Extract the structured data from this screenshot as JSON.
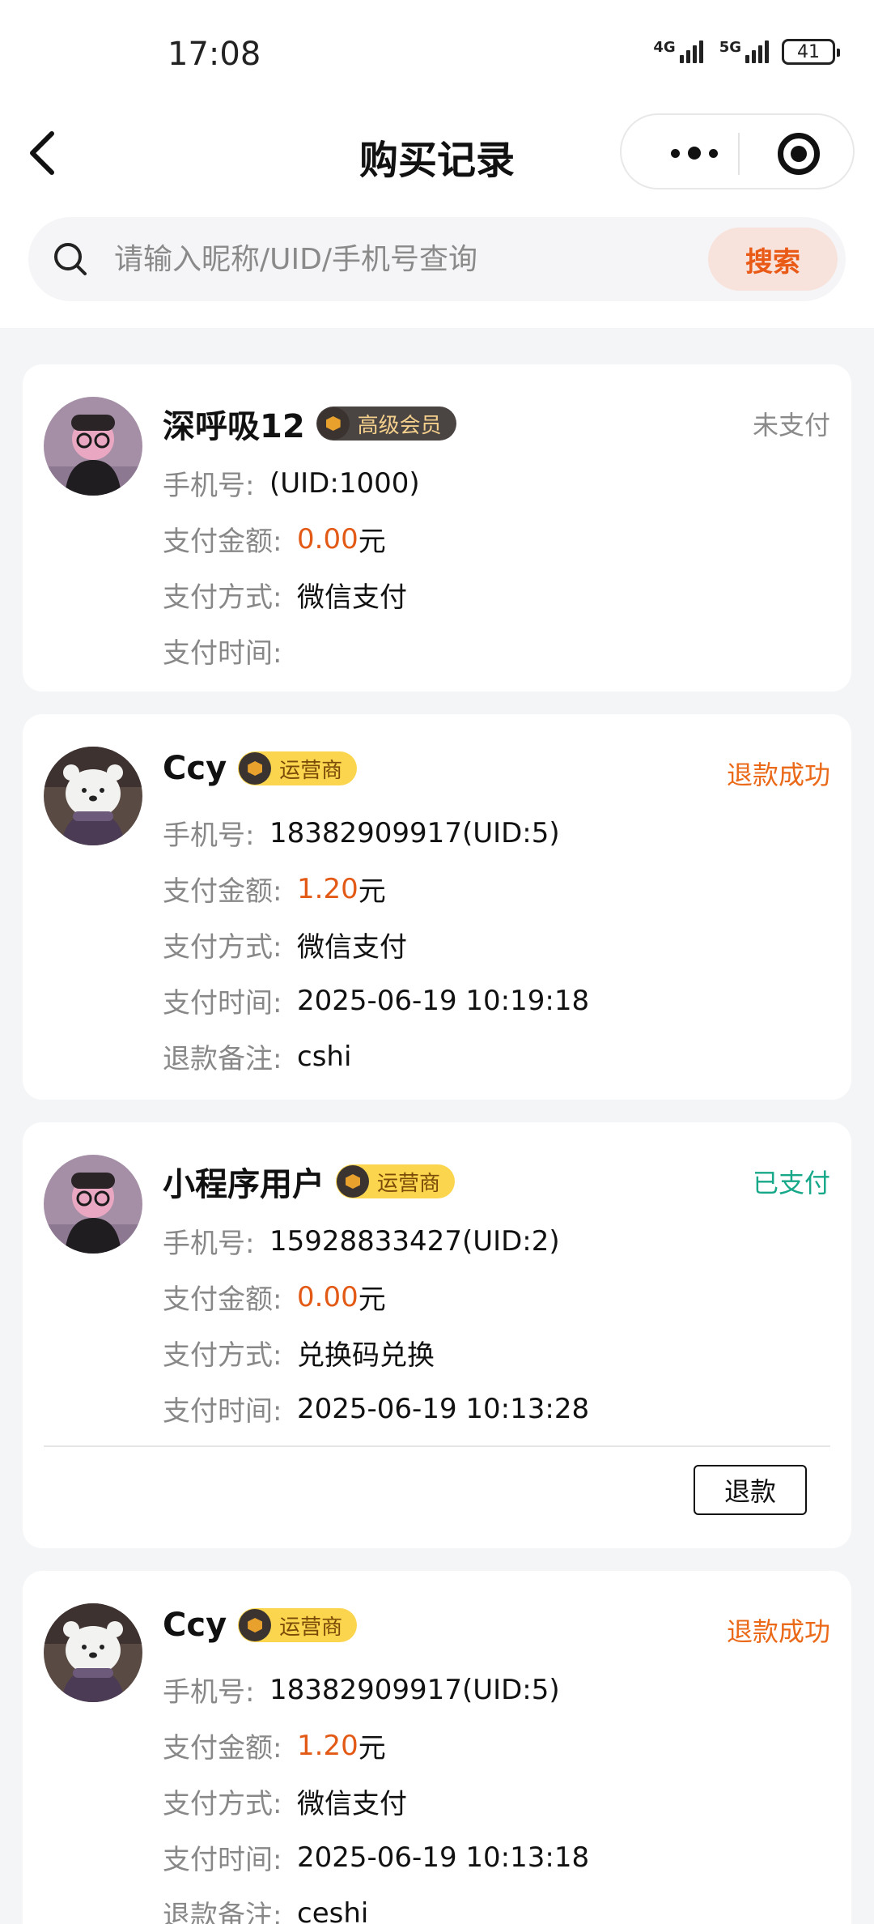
{
  "status_bar": {
    "time": "17:08",
    "net1": "4G",
    "net2": "5G",
    "battery": "41"
  },
  "header": {
    "title": "购买记录"
  },
  "search": {
    "placeholder": "请输入昵称/UID/手机号查询",
    "button": "搜索"
  },
  "labels": {
    "phone": "手机号:",
    "amount": "支付金额:",
    "method": "支付方式:",
    "time": "支付时间:",
    "remark": "退款备注:",
    "unit": "元",
    "refund_button": "退款"
  },
  "colors": {
    "accent": "#ea5a17",
    "paid": "#17a88a",
    "unpaid": "#8a8a8a",
    "refunded": "#ea6a1a"
  },
  "records": [
    {
      "name": "深呼吸12",
      "badge": "高级会员",
      "status": "未支付",
      "phone": "(UID:1000)",
      "amount": "0.00",
      "method": "微信支付",
      "time": "",
      "remark": null
    },
    {
      "name": "Ccy",
      "badge": "运营商",
      "status": "退款成功",
      "phone": "18382909917(UID:5)",
      "amount": "1.20",
      "method": "微信支付",
      "time": "2025-06-19 10:19:18",
      "remark": "cshi"
    },
    {
      "name": "小程序用户",
      "badge": "运营商",
      "status": "已支付",
      "phone": "15928833427(UID:2)",
      "amount": "0.00",
      "method": "兑换码兑换",
      "time": "2025-06-19 10:13:28",
      "remark": null
    },
    {
      "name": "Ccy",
      "badge": "运营商",
      "status": "退款成功",
      "phone": "18382909917(UID:5)",
      "amount": "1.20",
      "method": "微信支付",
      "time": "2025-06-19 10:13:18",
      "remark": "ceshi"
    }
  ]
}
